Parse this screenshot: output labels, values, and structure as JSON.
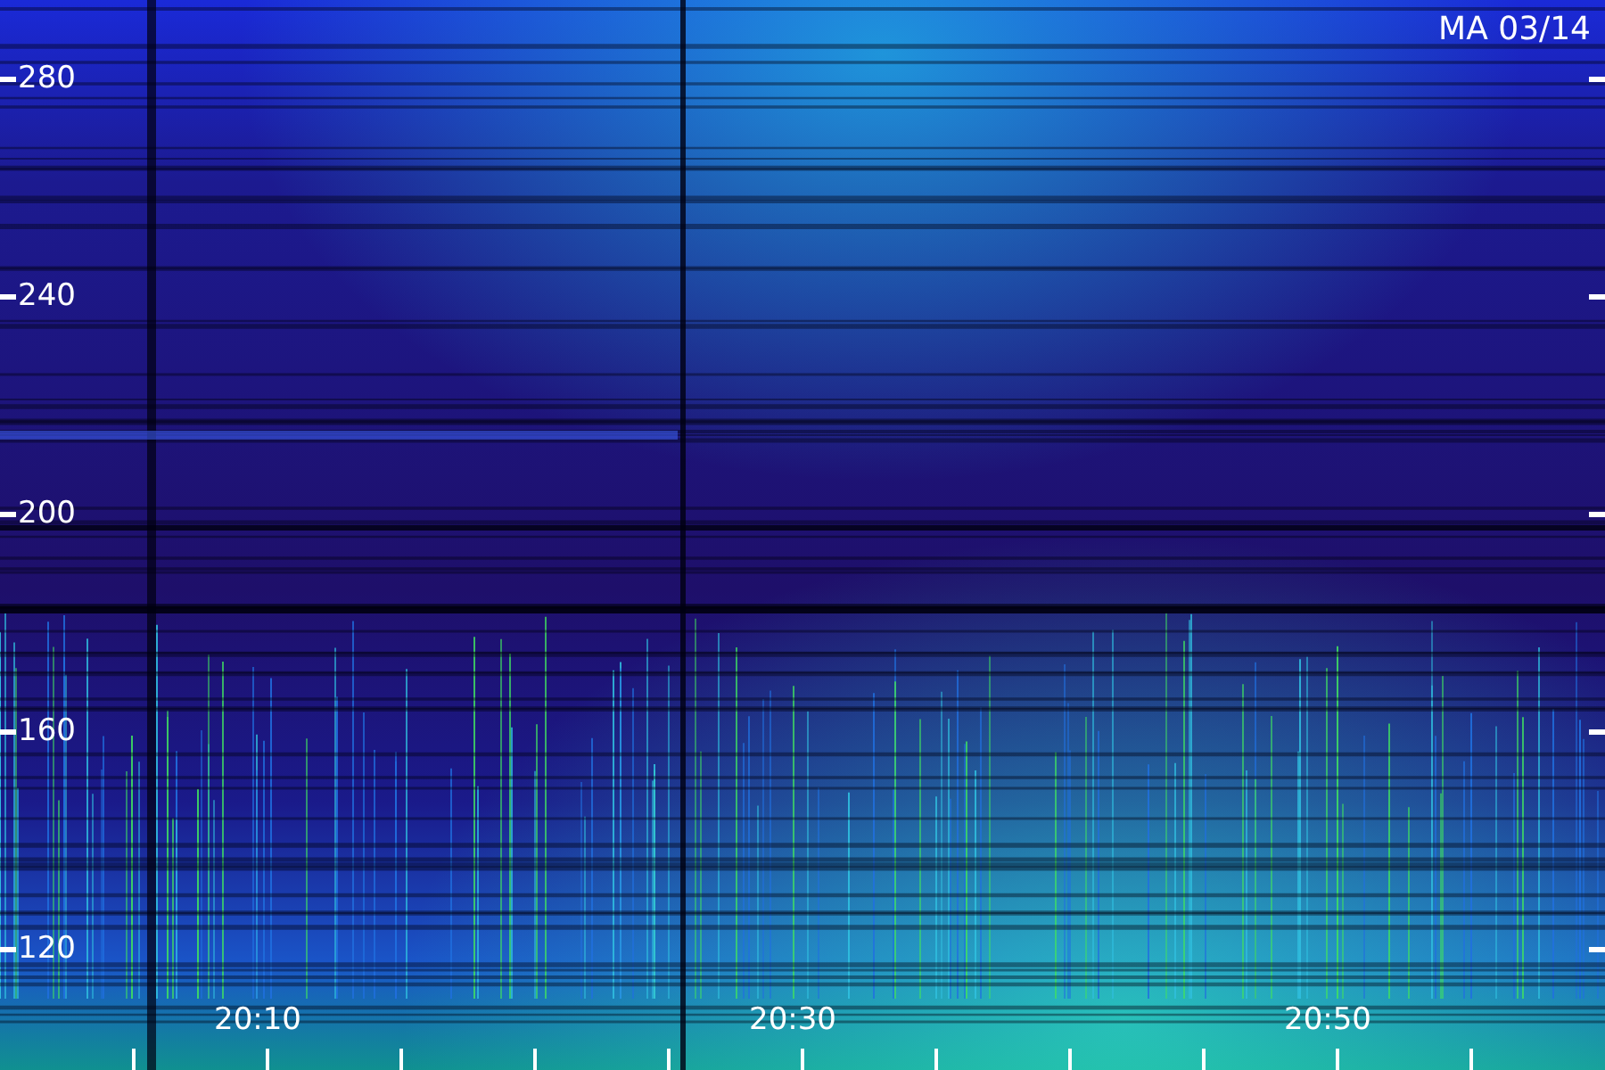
{
  "label": "MA 03/14",
  "y_axis": {
    "ticks": [
      "280",
      "240",
      "200",
      "160",
      "120"
    ]
  },
  "x_axis": {
    "ticks": [
      "20:10",
      "20:30",
      "20:50"
    ]
  }
}
